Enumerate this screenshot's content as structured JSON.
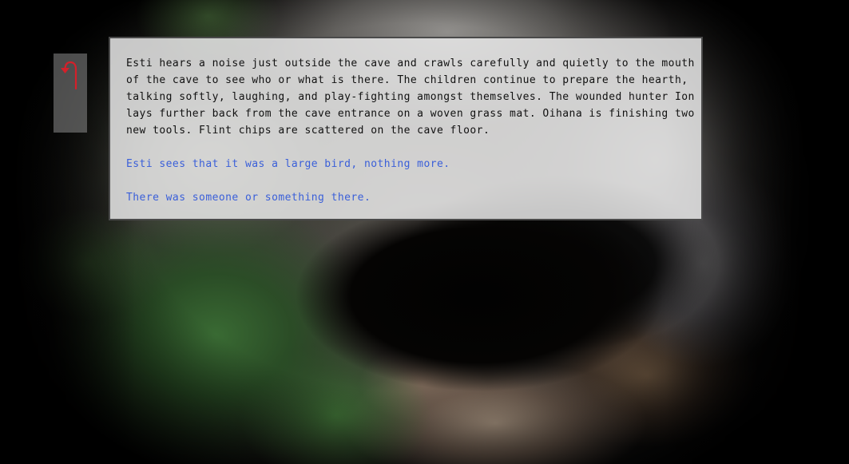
{
  "scene": {
    "background": "cave-entrance-photo"
  },
  "navigation": {
    "back_icon": "u-turn-back-arrow-icon",
    "back_icon_color": "#d4202a"
  },
  "story": {
    "narrative": "Esti hears a noise just outside the cave and crawls carefully and quietly to the mouth of the cave to see who or what is there. The children continue to prepare the hearth, talking softly, laughing, and play-fighting amongst themselves. The wounded hunter Ion lays further back from the cave entrance on a woven grass mat. Oihana is finishing two new tools. Flint chips are scattered on the cave floor.",
    "choices": [
      {
        "label": "Esti sees that it was a large bird, nothing more."
      },
      {
        "label": "There was someone or something there."
      }
    ],
    "choice_color": "#3a5fd9",
    "text_color": "#111111"
  }
}
